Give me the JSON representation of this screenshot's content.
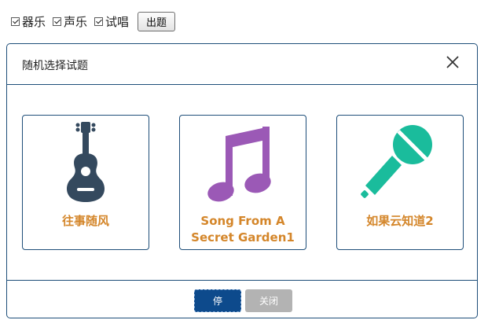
{
  "toolbar": {
    "checkboxes": [
      {
        "label": "器乐",
        "checked": true
      },
      {
        "label": "声乐",
        "checked": true
      },
      {
        "label": "试唱",
        "checked": true
      }
    ],
    "question_button": "出题"
  },
  "dialog": {
    "title": "随机选择试题",
    "cards": [
      {
        "label": "往事随风",
        "icon": "guitar-icon",
        "color": "#34495e"
      },
      {
        "label": "Song From A Secret Garden1",
        "icon": "music-note-icon",
        "color": "#9b59b6"
      },
      {
        "label": "如果云知道2",
        "icon": "microphone-icon",
        "color": "#1abc9c"
      }
    ],
    "stop_button": "停",
    "close_button": "关闭"
  },
  "colors": {
    "border": "#1e4e79",
    "label": "#d4862a",
    "stop_button_bg": "#0d4a8c",
    "close_button_bg": "#b3b3b3"
  }
}
